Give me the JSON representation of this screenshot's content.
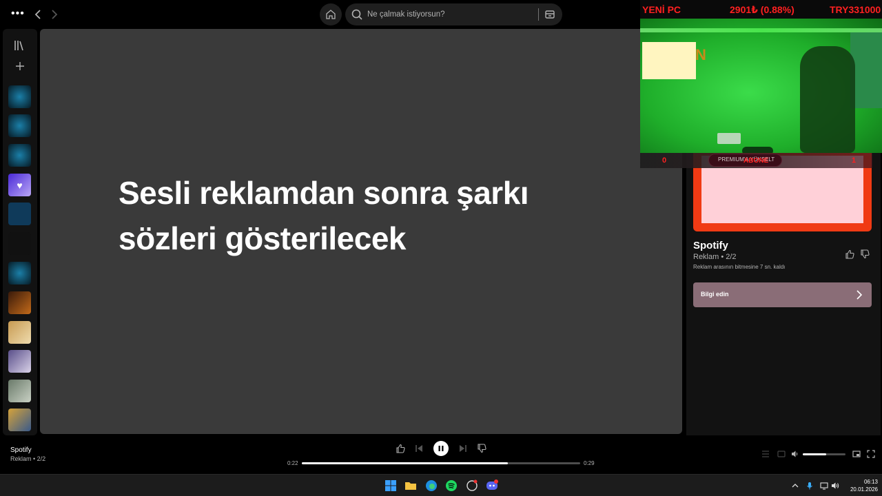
{
  "topbar": {
    "menu_icon": "more-horizontal-icon",
    "search_placeholder": "Ne çalmak istiyorsun?"
  },
  "main": {
    "lyrics_message": "Sesli reklamdan sonra şarkı sözleri gösterilecek"
  },
  "overlay": {
    "left_label": "YENİ PC",
    "center_label": "2901₺ (0.88%)",
    "right_label": "TRY331000",
    "bottom_left": "0",
    "bottom_right": "1",
    "pill_small": "PREMIUM'A YÜKSELT",
    "pill_big": "ABONE"
  },
  "right_panel": {
    "title": "Spotify",
    "subtitle": "Reklam • 2/2",
    "note": "Reklam arasının bitmesine 7 sn. kaldı",
    "learn_more": "Bilgi edin"
  },
  "player": {
    "track_title": "Spotify",
    "track_sub": "Reklam • 2/2",
    "elapsed": "0:22",
    "total": "0:29",
    "progress": 0.74,
    "volume": 0.55
  },
  "taskbar": {
    "time": "06:13",
    "date": "20.01.2026"
  },
  "colors": {
    "spotify_green": "#1ed760",
    "ad_frame": "#f03a14",
    "overlay_red": "#ff2020",
    "learn_button": "#8a6d77"
  }
}
